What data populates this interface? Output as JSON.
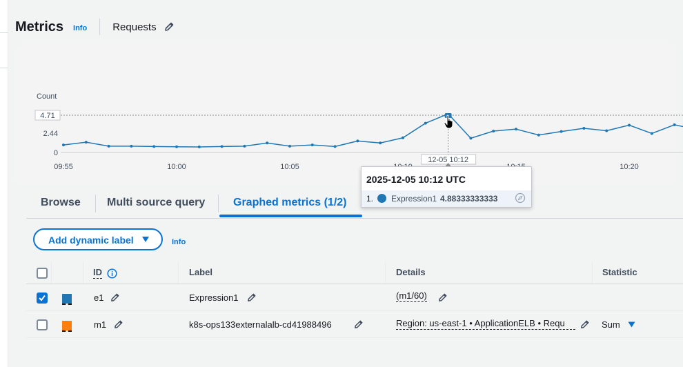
{
  "header": {
    "title": "Metrics",
    "info": "Info",
    "graph_name": "Requests"
  },
  "chart_data": {
    "type": "line",
    "ylabel": "Count",
    "y_ticks": [
      "0",
      "2.44"
    ],
    "y_marker": "4.71",
    "ylim": [
      0,
      4.71
    ],
    "x_ticks": [
      "09:55",
      "10:00",
      "10:05",
      "10:10",
      "10:15",
      "10:20"
    ],
    "x_marker": "12-05 10:12",
    "series": [
      {
        "name": "Expression1",
        "color": "#1f77b4",
        "x": [
          "09:55",
          "09:56",
          "09:57",
          "09:58",
          "09:59",
          "10:00",
          "10:01",
          "10:02",
          "10:03",
          "10:04",
          "10:05",
          "10:06",
          "10:07",
          "10:08",
          "10:09",
          "10:10",
          "10:11",
          "10:12",
          "10:13",
          "10:14",
          "10:15",
          "10:16",
          "10:17",
          "10:18",
          "10:19",
          "10:20",
          "10:21",
          "10:22",
          "10:23"
        ],
        "values": [
          0.95,
          1.3,
          0.8,
          0.8,
          0.75,
          0.72,
          0.7,
          0.75,
          0.8,
          1.2,
          0.8,
          0.95,
          0.75,
          1.45,
          1.2,
          1.85,
          3.7,
          4.88,
          1.8,
          2.7,
          2.95,
          2.2,
          2.65,
          3.05,
          2.75,
          3.45,
          2.4,
          3.5,
          2.9
        ]
      }
    ]
  },
  "tooltip": {
    "title": "2025-12-05 10:12 UTC",
    "index": "1.",
    "label": "Expression1",
    "value": "4.88333333333"
  },
  "tabs": [
    {
      "label": "Browse"
    },
    {
      "label": "Multi source query"
    },
    {
      "label": "Graphed metrics (1/2)",
      "active": true
    }
  ],
  "actions": {
    "add_dynamic_label": "Add dynamic label",
    "info": "Info"
  },
  "table": {
    "headers": {
      "id": "ID",
      "label": "Label",
      "details": "Details",
      "statistic": "Statistic"
    },
    "rows": [
      {
        "checked": true,
        "color": "#1f77b4",
        "id": "e1",
        "label": "Expression1",
        "details": "(m1/60)",
        "statistic": ""
      },
      {
        "checked": false,
        "color": "#ff7f0e",
        "id": "m1",
        "label": "k8s-ops133externalalb-cd41988496",
        "details": "Region: us-east-1 • ApplicationELB • Requ",
        "statistic": "Sum"
      }
    ]
  }
}
